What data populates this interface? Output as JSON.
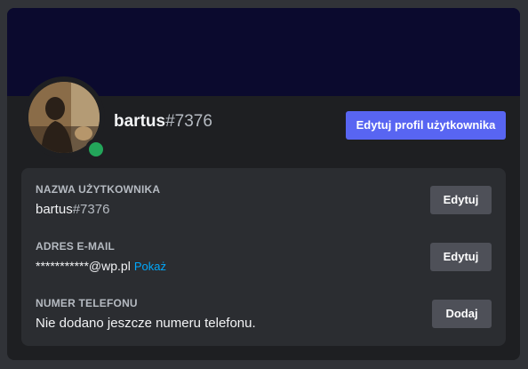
{
  "profile": {
    "name": "bartus",
    "discriminator": "#7376",
    "edit_profile_label": "Edytuj profil użytkownika",
    "status": "online",
    "colors": {
      "accent": "#5865f2",
      "banner": "#0b0a2e",
      "status_online": "#23a55a",
      "link": "#00a8fc"
    }
  },
  "fields": {
    "username": {
      "label": "NAZWA UŻYTKOWNIKA",
      "name": "bartus",
      "discriminator": "#7376",
      "button": "Edytuj"
    },
    "email": {
      "label": "ADRES E-MAIL",
      "value": "***********@wp.pl",
      "reveal": "Pokaż",
      "button": "Edytuj"
    },
    "phone": {
      "label": "NUMER TELEFONU",
      "value": "Nie dodano jeszcze numeru telefonu.",
      "button": "Dodaj"
    }
  }
}
